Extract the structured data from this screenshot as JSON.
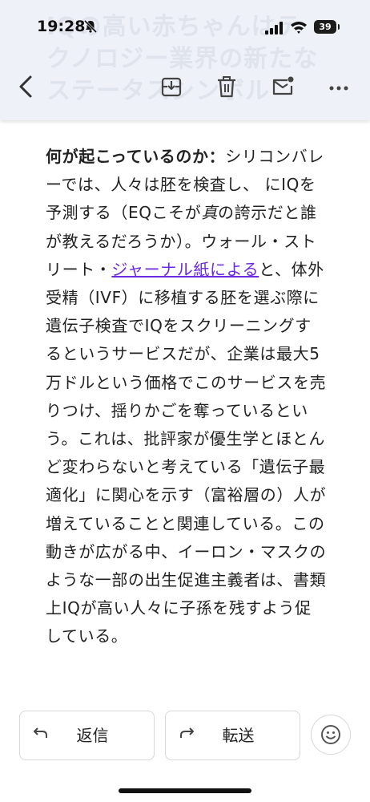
{
  "status_bar": {
    "time": "19:28",
    "battery_level": "39"
  },
  "header": {
    "background_subject": "IQの高い赤ちゃんはテクノロジー業界の新たなステータスシンボル",
    "icons": [
      "back-arrow-icon",
      "archive-icon",
      "trash-icon",
      "mark-unread-icon",
      "more-icon"
    ]
  },
  "message": {
    "lead_bold": "何が起こっているのか：",
    "segment_1": "シリコンバレーでは、人々は胚を検査し、 にIQを予測する（EQこそが",
    "emphasis": "真",
    "segment_2": "の誇示だと誰が教えるだろうか）。ウォール・ストリート・",
    "link_text": "ジャーナル紙による",
    "segment_3": "と、体外受精（IVF）に移植する胚を選ぶ際に遺伝子検査でIQをスクリーニングするというサービスだが、企業は最大5万ドルという価格でこのサービスを売りつけ、揺りかごを奪っているという。これは、批評家が優生学とほとんど変わらないと考えている「遺伝子最適化」に関心を示す（富裕層の）人が増えていることと関連している。この動きが広がる中、イーロン・マスクのような一部の出生促進主義者は、書類上IQが高い人々に子孫を残すよう促している。"
  },
  "actions": {
    "reply_label": "返信",
    "forward_label": "転送"
  },
  "colors": {
    "header_bg": "#eef1f8",
    "link": "#6a2be0"
  }
}
